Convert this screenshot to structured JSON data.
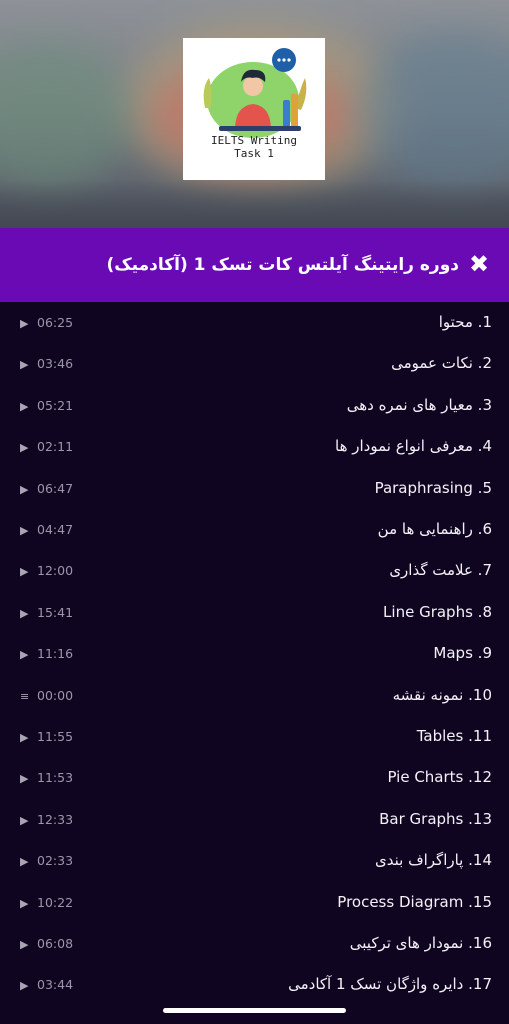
{
  "thumbnail": {
    "caption_line1": "IELTS Writing",
    "caption_line2": "Task 1"
  },
  "header": {
    "close_icon": "close-icon",
    "title": "دوره رایتینگ آیلتس کات تسک 1 (آکادمیک)"
  },
  "colors": {
    "header_bg": "#6a0ab5",
    "list_bg": "#0f0521",
    "text": "#f4f2f8",
    "duration": "#9b97a6"
  },
  "playlist": [
    {
      "label": "1. محتوا",
      "duration": "06:25",
      "icon": "play-icon"
    },
    {
      "label": "2. نکات عمومی",
      "duration": "03:46",
      "icon": "play-icon"
    },
    {
      "label": "3. معیار های نمره دهی",
      "duration": "05:21",
      "icon": "play-icon"
    },
    {
      "label": "4. معرفی انواع نمودار ها",
      "duration": "02:11",
      "icon": "play-icon"
    },
    {
      "label": "5. Paraphrasing",
      "duration": "06:47",
      "icon": "play-icon"
    },
    {
      "label": "6. راهنمایی ها من",
      "duration": "04:47",
      "icon": "play-icon"
    },
    {
      "label": "7. علامت گذاری",
      "duration": "12:00",
      "icon": "play-icon"
    },
    {
      "label": "8. Line Graphs",
      "duration": "15:41",
      "icon": "play-icon"
    },
    {
      "label": "9. Maps",
      "duration": "11:16",
      "icon": "play-icon"
    },
    {
      "label": "10. نمونه نقشه",
      "duration": "00:00",
      "icon": "list-icon"
    },
    {
      "label": "11. Tables",
      "duration": "11:55",
      "icon": "play-icon"
    },
    {
      "label": "12. Pie Charts",
      "duration": "11:53",
      "icon": "play-icon"
    },
    {
      "label": "13. Bar Graphs",
      "duration": "12:33",
      "icon": "play-icon"
    },
    {
      "label": "14. پاراگراف بندی",
      "duration": "02:33",
      "icon": "play-icon"
    },
    {
      "label": "15. Process Diagram",
      "duration": "10:22",
      "icon": "play-icon"
    },
    {
      "label": "16. نمودار های ترکیبی",
      "duration": "06:08",
      "icon": "play-icon"
    },
    {
      "label": "17. دایره واژگان تسک 1 آکادمی",
      "duration": "03:44",
      "icon": "play-icon"
    }
  ]
}
